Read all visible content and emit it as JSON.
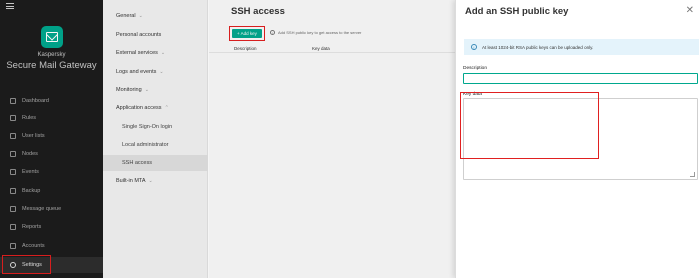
{
  "brand": {
    "line1": "Kaspersky",
    "line2": "Secure Mail Gateway"
  },
  "sidebar": {
    "items": [
      {
        "label": "Dashboard"
      },
      {
        "label": "Rules"
      },
      {
        "label": "User lists"
      },
      {
        "label": "Nodes"
      },
      {
        "label": "Events"
      },
      {
        "label": "Backup"
      },
      {
        "label": "Message queue"
      },
      {
        "label": "Reports"
      },
      {
        "label": "Accounts"
      },
      {
        "label": "Settings"
      }
    ]
  },
  "menu": {
    "items": [
      {
        "label": "General"
      },
      {
        "label": "Personal accounts"
      },
      {
        "label": "External services"
      },
      {
        "label": "Logs and events"
      },
      {
        "label": "Monitoring"
      },
      {
        "label": "Application access"
      },
      {
        "label": "Single Sign-On login"
      },
      {
        "label": "Local administrator"
      },
      {
        "label": "SSH access"
      },
      {
        "label": "Built-in MTA"
      }
    ]
  },
  "main": {
    "title": "SSH access",
    "add_button": "+ Add key",
    "hint": "Add SSH public key to get access to the server",
    "columns": [
      "Description",
      "Key data"
    ]
  },
  "drawer": {
    "title": "Add an SSH public key",
    "close": "✕",
    "info": "At least 1024-bit RSA public keys can be uploaded only.",
    "description_label": "Description",
    "description_value": "",
    "key_label": "Key data",
    "key_value": ""
  },
  "colors": {
    "accent": "#00a88e",
    "highlight": "#e02020",
    "sidebar_bg": "#1d1d1d"
  }
}
